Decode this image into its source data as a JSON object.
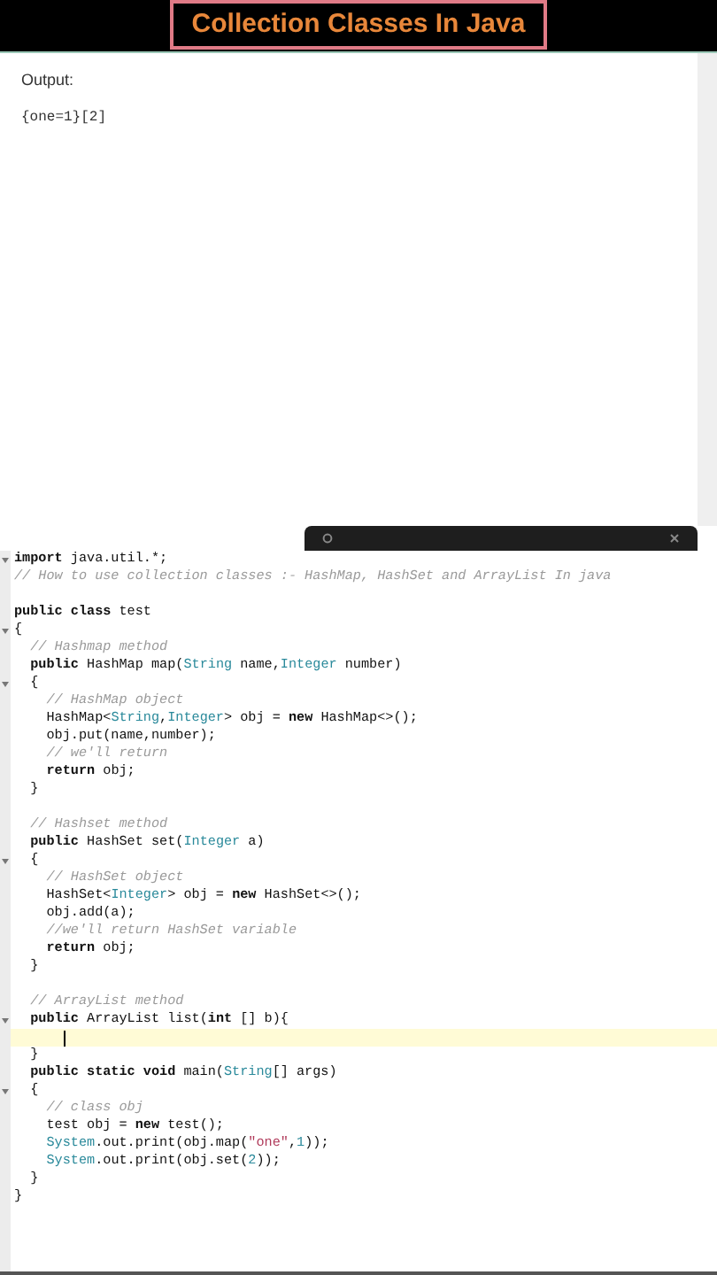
{
  "title": "Collection Classes In Java",
  "output": {
    "label": "Output:",
    "text": "{one=1}[2]"
  },
  "code_lines": [
    {
      "fold": true,
      "current": false,
      "tokens": [
        {
          "kind": "kw",
          "text": "import"
        },
        {
          "kind": "plain",
          "text": " java.util.*;"
        }
      ]
    },
    {
      "fold": false,
      "current": false,
      "tokens": [
        {
          "kind": "comment",
          "text": "// How to use collection classes :- HashMap, HashSet and ArrayList In java"
        }
      ]
    },
    {
      "fold": false,
      "current": false
    },
    {
      "fold": false,
      "current": false,
      "tokens": [
        {
          "kind": "kw",
          "text": "public class"
        },
        {
          "kind": "plain",
          "text": " test"
        }
      ]
    },
    {
      "fold": true,
      "current": false,
      "tokens": [
        {
          "kind": "plain",
          "text": "{"
        }
      ]
    },
    {
      "fold": false,
      "current": false,
      "tokens": [
        {
          "kind": "comment",
          "text": "  // Hashmap method"
        }
      ]
    },
    {
      "fold": false,
      "current": false,
      "tokens": [
        {
          "kind": "kw",
          "text": "  public"
        },
        {
          "kind": "plain",
          "text": " HashMap map("
        },
        {
          "kind": "type",
          "text": "String"
        },
        {
          "kind": "plain",
          "text": " name,"
        },
        {
          "kind": "type",
          "text": "Integer"
        },
        {
          "kind": "plain",
          "text": " number)"
        }
      ]
    },
    {
      "fold": true,
      "current": false,
      "tokens": [
        {
          "kind": "plain",
          "text": "  {"
        }
      ]
    },
    {
      "fold": false,
      "current": false,
      "tokens": [
        {
          "kind": "comment",
          "text": "    // HashMap object"
        }
      ]
    },
    {
      "fold": false,
      "current": false,
      "tokens": [
        {
          "kind": "plain",
          "text": "    HashMap<"
        },
        {
          "kind": "type",
          "text": "String"
        },
        {
          "kind": "plain",
          "text": ","
        },
        {
          "kind": "type",
          "text": "Integer"
        },
        {
          "kind": "plain",
          "text": "> obj = "
        },
        {
          "kind": "kw",
          "text": "new"
        },
        {
          "kind": "plain",
          "text": " HashMap<>();"
        }
      ]
    },
    {
      "fold": false,
      "current": false,
      "tokens": [
        {
          "kind": "plain",
          "text": "    obj.put(name,number);"
        }
      ]
    },
    {
      "fold": false,
      "current": false,
      "tokens": [
        {
          "kind": "comment",
          "text": "    // we'll return"
        }
      ]
    },
    {
      "fold": false,
      "current": false,
      "tokens": [
        {
          "kind": "kw",
          "text": "    return"
        },
        {
          "kind": "plain",
          "text": " obj;"
        }
      ]
    },
    {
      "fold": false,
      "current": false,
      "tokens": [
        {
          "kind": "plain",
          "text": "  }"
        }
      ]
    },
    {
      "fold": false,
      "current": false
    },
    {
      "fold": false,
      "current": false,
      "tokens": [
        {
          "kind": "comment",
          "text": "  // Hashset method"
        }
      ]
    },
    {
      "fold": false,
      "current": false,
      "tokens": [
        {
          "kind": "kw",
          "text": "  public"
        },
        {
          "kind": "plain",
          "text": " HashSet set("
        },
        {
          "kind": "type",
          "text": "Integer"
        },
        {
          "kind": "plain",
          "text": " a)"
        }
      ]
    },
    {
      "fold": true,
      "current": false,
      "tokens": [
        {
          "kind": "plain",
          "text": "  {"
        }
      ]
    },
    {
      "fold": false,
      "current": false,
      "tokens": [
        {
          "kind": "comment",
          "text": "    // HashSet object"
        }
      ]
    },
    {
      "fold": false,
      "current": false,
      "tokens": [
        {
          "kind": "plain",
          "text": "    HashSet<"
        },
        {
          "kind": "type",
          "text": "Integer"
        },
        {
          "kind": "plain",
          "text": "> obj = "
        },
        {
          "kind": "kw",
          "text": "new"
        },
        {
          "kind": "plain",
          "text": " HashSet<>();"
        }
      ]
    },
    {
      "fold": false,
      "current": false,
      "tokens": [
        {
          "kind": "plain",
          "text": "    obj.add(a);"
        }
      ]
    },
    {
      "fold": false,
      "current": false,
      "tokens": [
        {
          "kind": "comment",
          "text": "    //we'll return HashSet variable"
        }
      ]
    },
    {
      "fold": false,
      "current": false,
      "tokens": [
        {
          "kind": "kw",
          "text": "    return"
        },
        {
          "kind": "plain",
          "text": " obj;"
        }
      ]
    },
    {
      "fold": false,
      "current": false,
      "tokens": [
        {
          "kind": "plain",
          "text": "  }"
        }
      ]
    },
    {
      "fold": false,
      "current": false
    },
    {
      "fold": false,
      "current": false,
      "tokens": [
        {
          "kind": "comment",
          "text": "  // ArrayList method"
        }
      ]
    },
    {
      "fold": true,
      "current": false,
      "tokens": [
        {
          "kind": "kw",
          "text": "  public"
        },
        {
          "kind": "plain",
          "text": " ArrayList list("
        },
        {
          "kind": "kw",
          "text": "int"
        },
        {
          "kind": "plain",
          "text": " [] b){"
        }
      ]
    },
    {
      "fold": false,
      "current": true
    },
    {
      "fold": false,
      "current": false,
      "tokens": [
        {
          "kind": "plain",
          "text": "  }"
        }
      ]
    },
    {
      "fold": false,
      "current": false,
      "tokens": [
        {
          "kind": "kw",
          "text": "  public static void"
        },
        {
          "kind": "plain",
          "text": " main("
        },
        {
          "kind": "type",
          "text": "String"
        },
        {
          "kind": "plain",
          "text": "[] args)"
        }
      ]
    },
    {
      "fold": true,
      "current": false,
      "tokens": [
        {
          "kind": "plain",
          "text": "  {"
        }
      ]
    },
    {
      "fold": false,
      "current": false,
      "tokens": [
        {
          "kind": "comment",
          "text": "    // class obj"
        }
      ]
    },
    {
      "fold": false,
      "current": false,
      "tokens": [
        {
          "kind": "plain",
          "text": "    test obj = "
        },
        {
          "kind": "kw",
          "text": "new"
        },
        {
          "kind": "plain",
          "text": " test();"
        }
      ]
    },
    {
      "fold": false,
      "current": false,
      "tokens": [
        {
          "kind": "type",
          "text": "    System"
        },
        {
          "kind": "plain",
          "text": ".out.print(obj.map("
        },
        {
          "kind": "string",
          "text": "\"one\""
        },
        {
          "kind": "plain",
          "text": ","
        },
        {
          "kind": "number",
          "text": "1"
        },
        {
          "kind": "plain",
          "text": "));"
        }
      ]
    },
    {
      "fold": false,
      "current": false,
      "tokens": [
        {
          "kind": "type",
          "text": "    System"
        },
        {
          "kind": "plain",
          "text": ".out.print(obj.set("
        },
        {
          "kind": "number",
          "text": "2"
        },
        {
          "kind": "plain",
          "text": "));"
        }
      ]
    },
    {
      "fold": false,
      "current": false,
      "tokens": [
        {
          "kind": "plain",
          "text": "  }"
        }
      ]
    },
    {
      "fold": false,
      "current": false,
      "tokens": [
        {
          "kind": "plain",
          "text": "}"
        }
      ]
    }
  ]
}
